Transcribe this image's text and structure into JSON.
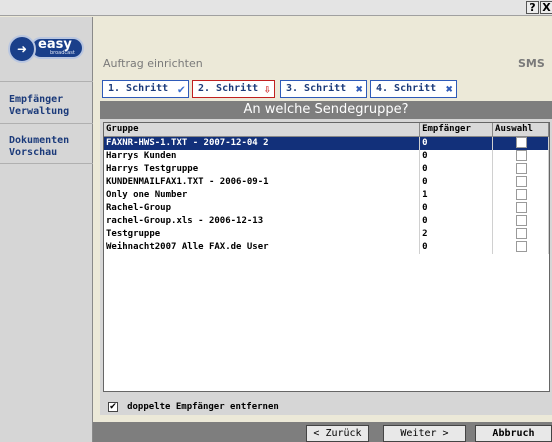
{
  "titlebar": {
    "help_label": "?",
    "close_label": "X"
  },
  "logo": {
    "text": "easy",
    "subtext": "broadcast"
  },
  "sidebar": {
    "items": [
      {
        "label_line1": "Empfänger",
        "label_line2": "Verwaltung"
      },
      {
        "label_line1": "Dokumenten",
        "label_line2": "Vorschau"
      }
    ]
  },
  "header": {
    "title": "Auftrag einrichten",
    "right_label": "SMS"
  },
  "steps": [
    {
      "label": "1. Schritt",
      "icon": "check-icon",
      "active": false
    },
    {
      "label": "2. Schritt",
      "icon": "arrow-down-icon",
      "active": true
    },
    {
      "label": "3. Schritt",
      "icon": "x-icon",
      "active": false
    },
    {
      "label": "4. Schritt",
      "icon": "x-icon",
      "active": false
    }
  ],
  "question": "An welche Sendegruppe?",
  "table": {
    "columns": [
      "Gruppe",
      "Empfänger",
      "Auswahl"
    ],
    "rows": [
      {
        "name": "FAXNR-HWS-1.TXT - 2007-12-04 2",
        "count": "0",
        "selected": true
      },
      {
        "name": "Harrys Kunden",
        "count": "0",
        "selected": false
      },
      {
        "name": "Harrys Testgruppe",
        "count": "0",
        "selected": false
      },
      {
        "name": "KUNDENMAILFAX1.TXT - 2006-09-1",
        "count": "0",
        "selected": false
      },
      {
        "name": "Only one Number",
        "count": "1",
        "selected": false
      },
      {
        "name": "Rachel-Group",
        "count": "0",
        "selected": false
      },
      {
        "name": "rachel-Group.xls - 2006-12-13",
        "count": "0",
        "selected": false
      },
      {
        "name": "Testgruppe",
        "count": "2",
        "selected": false
      },
      {
        "name": "Weihnacht2007 Alle FAX.de User",
        "count": "0",
        "selected": false
      }
    ]
  },
  "footer_option": {
    "checked": true,
    "label": "doppelte Empfänger entfernen"
  },
  "buttons": {
    "back": "< Zurück",
    "next": "Weiter >",
    "cancel": "Abbruch"
  },
  "colors": {
    "selection": "#12307a",
    "accent": "#1b3a7a",
    "active_step_border": "#c02020"
  }
}
